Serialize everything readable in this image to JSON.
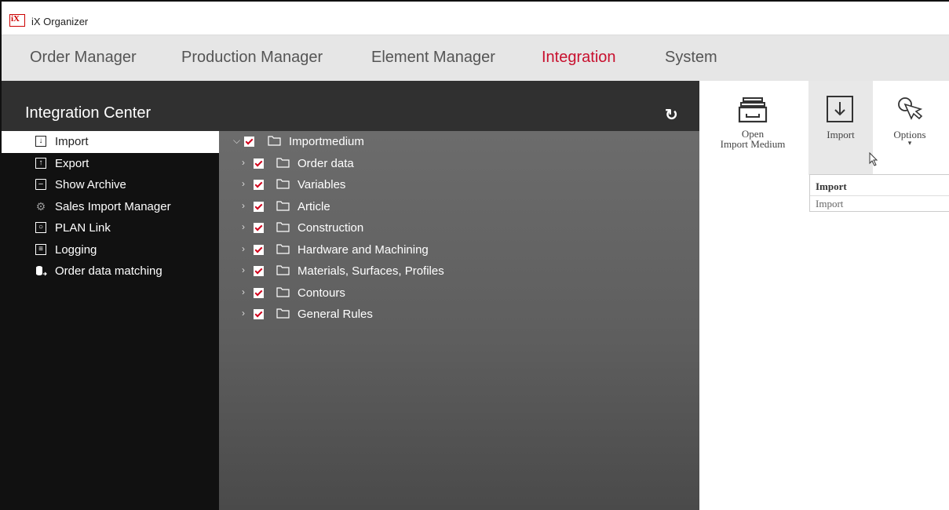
{
  "window": {
    "title": "iX Organizer",
    "logo_text": "iX"
  },
  "menu": [
    {
      "label": "Order Manager",
      "active": false
    },
    {
      "label": "Production Manager",
      "active": false
    },
    {
      "label": "Element Manager",
      "active": false
    },
    {
      "label": "Integration",
      "active": true
    },
    {
      "label": "System",
      "active": false
    }
  ],
  "panel": {
    "title": "Integration Center",
    "refresh_icon": "refresh-icon"
  },
  "nav": [
    {
      "label": "Import",
      "icon": "import-icon",
      "active": true
    },
    {
      "label": "Export",
      "icon": "export-icon",
      "active": false
    },
    {
      "label": "Show Archive",
      "icon": "archive-icon",
      "active": false
    },
    {
      "label": "Sales Import Manager",
      "icon": "gears-icon",
      "active": false
    },
    {
      "label": "PLAN Link",
      "icon": "plan-link-icon",
      "active": false
    },
    {
      "label": "Logging",
      "icon": "logging-icon",
      "active": false
    },
    {
      "label": "Order data matching",
      "icon": "database-sync-icon",
      "active": false
    }
  ],
  "tree": {
    "root": {
      "label": "Importmedium",
      "checked": true,
      "expanded": true
    },
    "children": [
      {
        "label": "Order data",
        "checked": true
      },
      {
        "label": "Variables",
        "checked": true
      },
      {
        "label": "Article",
        "checked": true
      },
      {
        "label": "Construction",
        "checked": true
      },
      {
        "label": "Hardware and Machining",
        "checked": true
      },
      {
        "label": "Materials, Surfaces, Profiles",
        "checked": true
      },
      {
        "label": "Contours",
        "checked": true
      },
      {
        "label": "General Rules",
        "checked": true
      }
    ]
  },
  "ribbon": {
    "open_import": {
      "line1": "Open",
      "line2": "Import Medium"
    },
    "import": {
      "label": "Import"
    },
    "options": {
      "label": "Options",
      "arrow": "▾"
    }
  },
  "dropdown": {
    "title": "Import",
    "subtitle": "Import"
  },
  "colors": {
    "accent": "#c8102e",
    "checkbox_mark": "#d0021b",
    "left_panel": "#111111",
    "header": "#303030"
  }
}
